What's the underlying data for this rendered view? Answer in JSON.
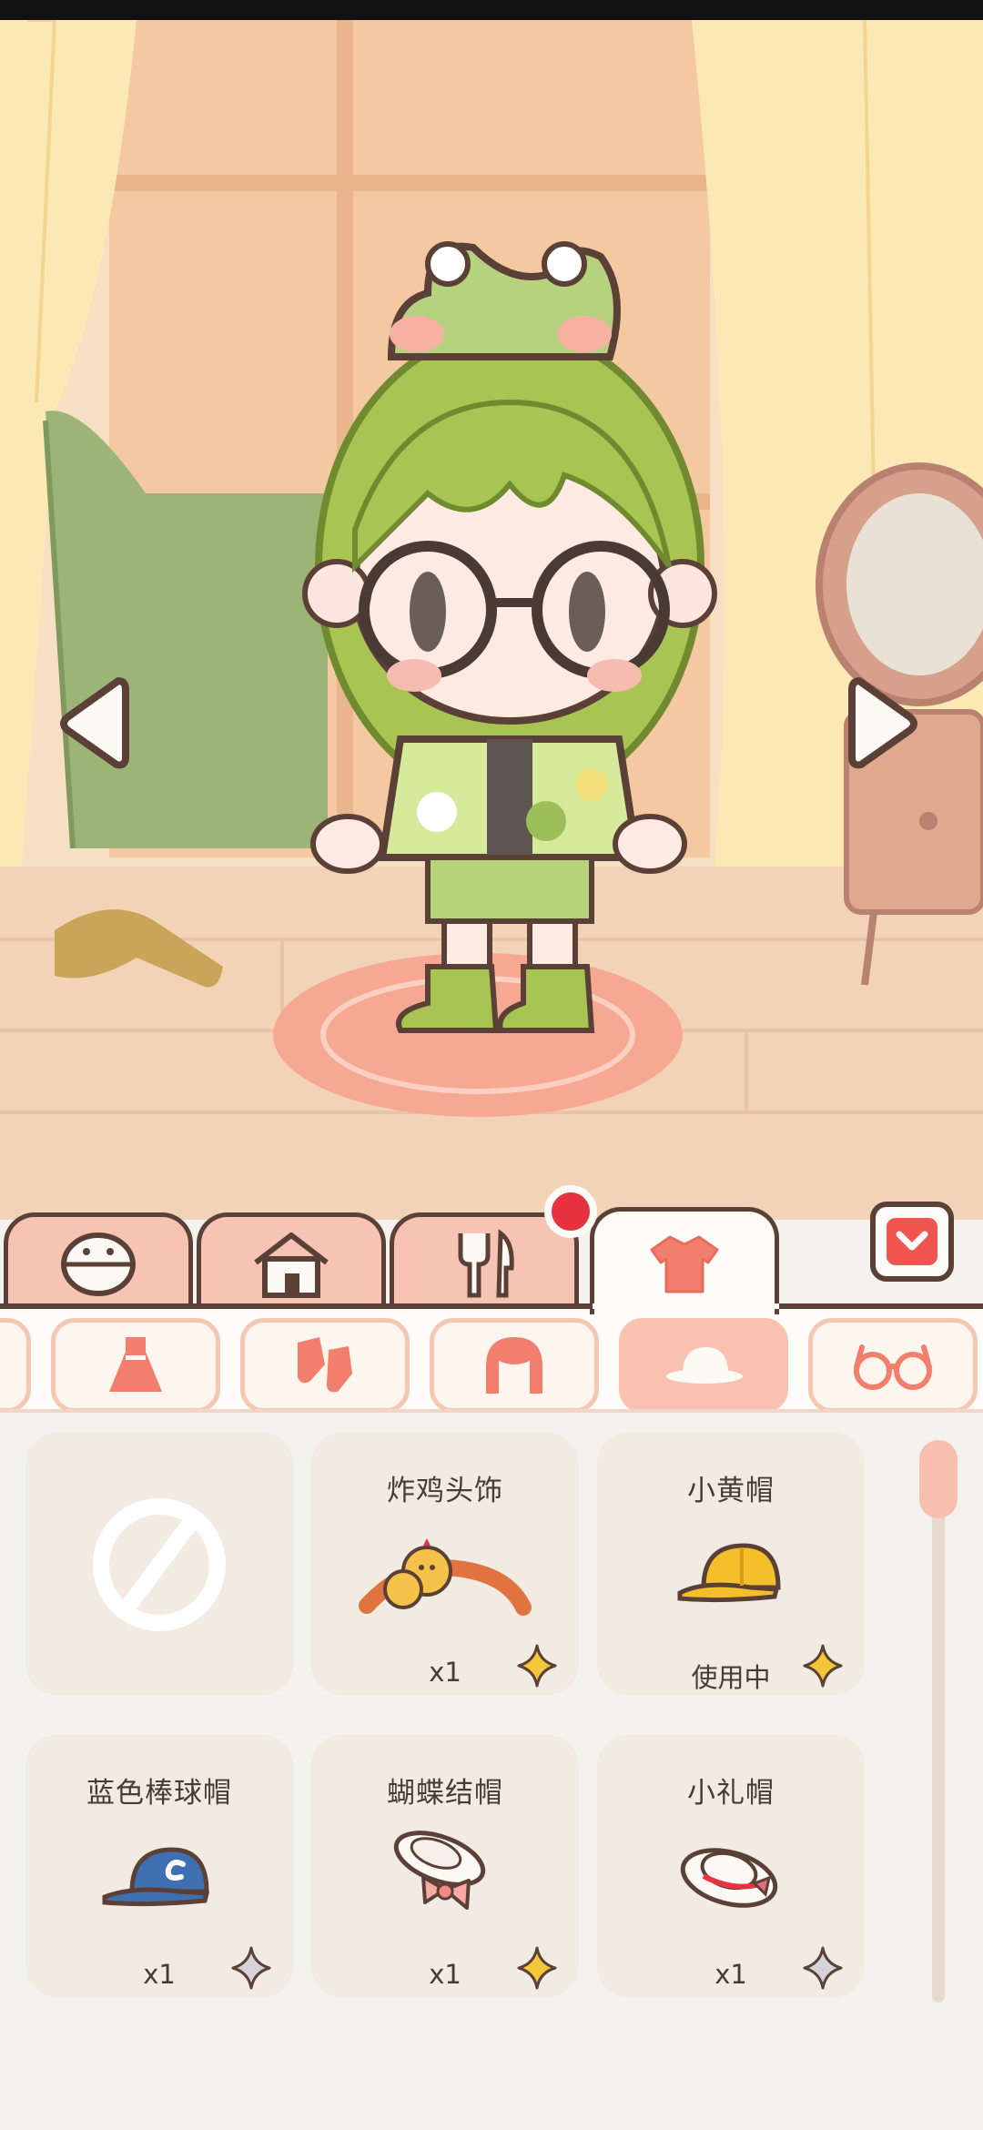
{
  "scene": {
    "character_name": "",
    "description_hidden": ""
  },
  "tabs": [
    {
      "icon": "bowl-icon"
    },
    {
      "icon": "house-icon"
    },
    {
      "icon": "fork-knife-icon"
    },
    {
      "icon": "shirt-icon"
    }
  ],
  "categories": [
    {
      "icon": "partial-icon"
    },
    {
      "icon": "dress-icon"
    },
    {
      "icon": "socks-icon"
    },
    {
      "icon": "hair-icon"
    },
    {
      "icon": "hat-icon"
    },
    {
      "icon": "glasses-icon"
    }
  ],
  "items": [
    {
      "title": "",
      "count": "",
      "icon": "none-icon"
    },
    {
      "title": "炸鸡头饰",
      "count": "x1",
      "icon": "chick-headband-icon"
    },
    {
      "title": "小黄帽",
      "count": "使用中",
      "icon": "yellow-cap-icon"
    },
    {
      "title": "蓝色棒球帽",
      "count": "x1",
      "icon": "blue-baseball-cap-icon"
    },
    {
      "title": "蝴蝶结帽",
      "count": "x1",
      "icon": "bow-hat-icon"
    },
    {
      "title": "小礼帽",
      "count": "x1",
      "icon": "small-top-hat-icon"
    }
  ],
  "colors": {
    "tab": "#f7c3b3",
    "tab_active": "#fdfcf8",
    "outline": "#5a4037",
    "notification": "#e8323f",
    "card_bg": "#f1ebe2",
    "star_gold": "#f5c63a"
  }
}
